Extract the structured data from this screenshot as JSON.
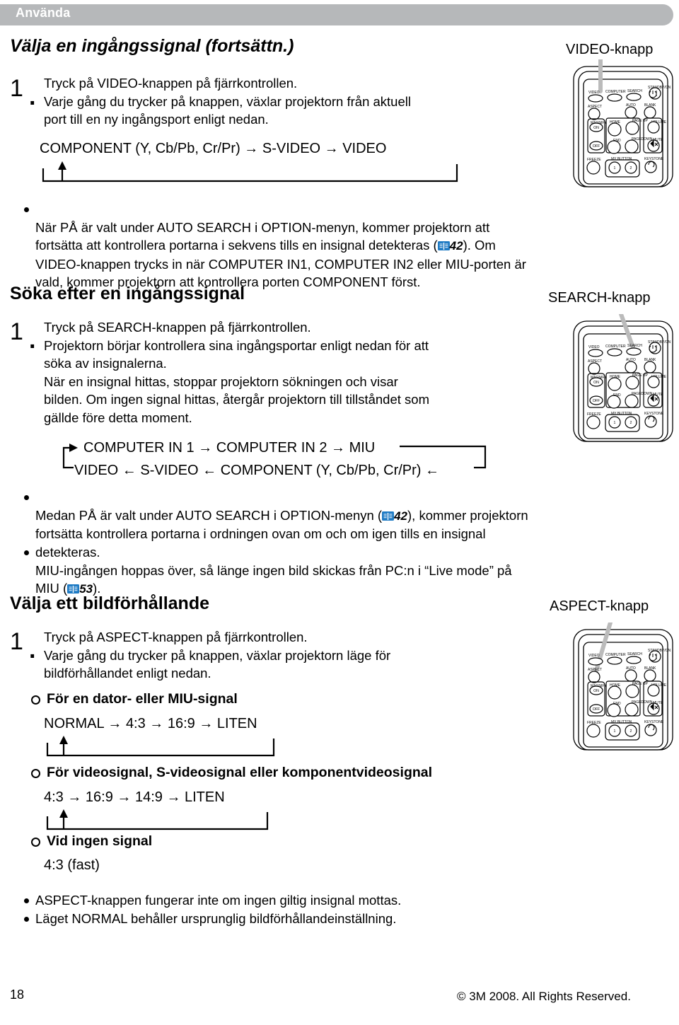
{
  "header": {
    "banner_label": "Använda"
  },
  "sections": [
    {
      "id": "select-input-signal",
      "title": "Välja en ingångssignal (fortsättn.)",
      "step_number": "1",
      "step_dot": ".",
      "step_text": "Tryck på VIDEO-knappen på fjärrkontrollen.\nVarje gång du trycker på knappen, växlar projektorn från aktuell\nport till en ny ingångsport enligt nedan.",
      "flow": "COMPONENT (Y, Cb/Pb, Cr/Pr) → S-VIDEO → VIDEO",
      "notes": [
        {
          "before": "När PÅ är valt under AUTO SEARCH i OPTION-menyn, kommer projektorn att\nfortsätta att kontrollera portarna i sekvens tills en insignal detekteras (",
          "page_ref": "42",
          "after": "). Om\nVIDEO-knappen trycks in när COMPUTER IN1, COMPUTER IN2 eller MIU-porten är\nvald, kommer projektorn att kontrollera porten COMPONENT först."
        }
      ],
      "remote_label": "VIDEO-knapp",
      "highlighted_button": "VIDEO"
    },
    {
      "id": "search-input-signal",
      "title": "Söka efter en ingångssignal",
      "step_number": "1",
      "step_dot": ".",
      "step_text": "Tryck på SEARCH-knappen på fjärrkontrollen.\nProjektorn börjar kontrollera sina ingångsportar enligt nedan för att\nsöka av insignalerna.\nNär en insignal hittas, stoppar projektorn sökningen och visar\nbilden. Om ingen signal hittas, återgår projektorn till tillståndet som\ngällde före detta moment.",
      "flow_line1": "COMPUTER IN 1 → COMPUTER IN 2 → MIU",
      "flow_line2": "VIDEO ← S-VIDEO ← COMPONENT (Y, Cb/Pb, Cr/Pr) ←",
      "notes": [
        {
          "before": "Medan PÅ är valt under AUTO SEARCH i OPTION-menyn (",
          "page_ref": "42",
          "after": "), kommer projektorn\nfortsätta kontrollera portarna i ordningen ovan om och om igen tills en insignal\ndetekteras."
        },
        {
          "before": "MIU-ingången hoppas över, så länge ingen bild skickas från PC:n i “Live mode” på\nMIU (",
          "page_ref": "53",
          "after": ")."
        }
      ],
      "remote_label": "SEARCH-knapp",
      "highlighted_button": "SEARCH"
    },
    {
      "id": "select-aspect-ratio",
      "title": "Välja ett bildförhållande",
      "step_number": "1",
      "step_dot": ".",
      "step_text": "Tryck på ASPECT-knappen på fjärrkontrollen.\nVarje gång du trycker på knappen, växlar projektorn läge för\nbildförhållandet enligt nedan.",
      "subsections": [
        {
          "heading": "För en dator- eller MIU-signal",
          "flow": "NORMAL → 4:3 → 16:9 → LITEN",
          "has_loop": true
        },
        {
          "heading": "För videosignal, S-videosignal eller komponentvideosignal",
          "flow": "4:3 → 16:9 → 14:9 → LITEN",
          "has_loop": true
        },
        {
          "heading": "Vid ingen signal",
          "flow": "4:3 (fast)",
          "has_loop": false
        }
      ],
      "notes": [
        {
          "before": "ASPECT-knappen fungerar inte om ingen giltig insignal mottas.",
          "page_ref": "",
          "after": ""
        },
        {
          "before": "Läget NORMAL behåller ursprunglig bildförhållandeinställning.",
          "page_ref": "",
          "after": ""
        }
      ],
      "remote_label": "ASPECT-knapp",
      "highlighted_button": "ASPECT"
    }
  ],
  "remote": {
    "buttons_row1": [
      "VIDEO",
      "COMPUTER",
      "SEARCH"
    ],
    "standby_label": "STANDBY/ON",
    "buttons_row2": [
      "ASPECT",
      "AUTO",
      "BLANK"
    ],
    "magnify_label": "MAGNIFY",
    "magnify_on": "ON",
    "magnify_off": "OFF",
    "nav_labels": [
      "HOME",
      "PAGE UP",
      "END",
      "PAGEDOWN"
    ],
    "volume_label": "VOLUME",
    "mute_label": "MUTE",
    "freeze_label": "FREEZE",
    "mybutton_label": "MY BUTTON",
    "mybutton_1": "1",
    "mybutton_2": "2",
    "keystone_label": "KEYSTONE"
  },
  "footer": {
    "page_number": "18",
    "copyright": "© 3M 2008.  All Rights Reserved."
  },
  "colors": {
    "banner_bg": "#b6b8ba",
    "banner_text": "#ffffff",
    "book_icon": "#1f7bc4",
    "text": "#000000"
  }
}
